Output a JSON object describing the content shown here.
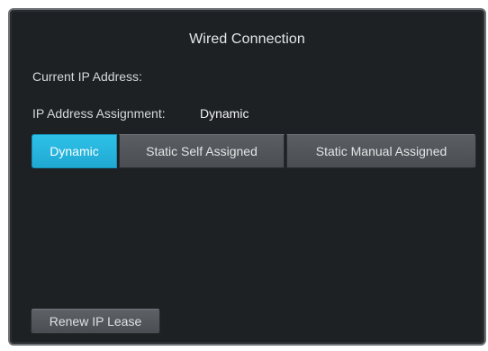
{
  "panel": {
    "title": "Wired Connection",
    "current_ip_label": "Current IP Address:",
    "current_ip_value": "",
    "assignment_label": "IP Address Assignment:",
    "assignment_value": "Dynamic",
    "segments": [
      {
        "label": "Dynamic",
        "active": true
      },
      {
        "label": "Static Self Assigned",
        "active": false
      },
      {
        "label": "Static Manual Assigned",
        "active": false
      }
    ],
    "renew_label": "Renew IP Lease"
  },
  "colors": {
    "panel_bg": "#1e2124",
    "accent": "#2ec1e8",
    "button_bg": "#55585c"
  }
}
